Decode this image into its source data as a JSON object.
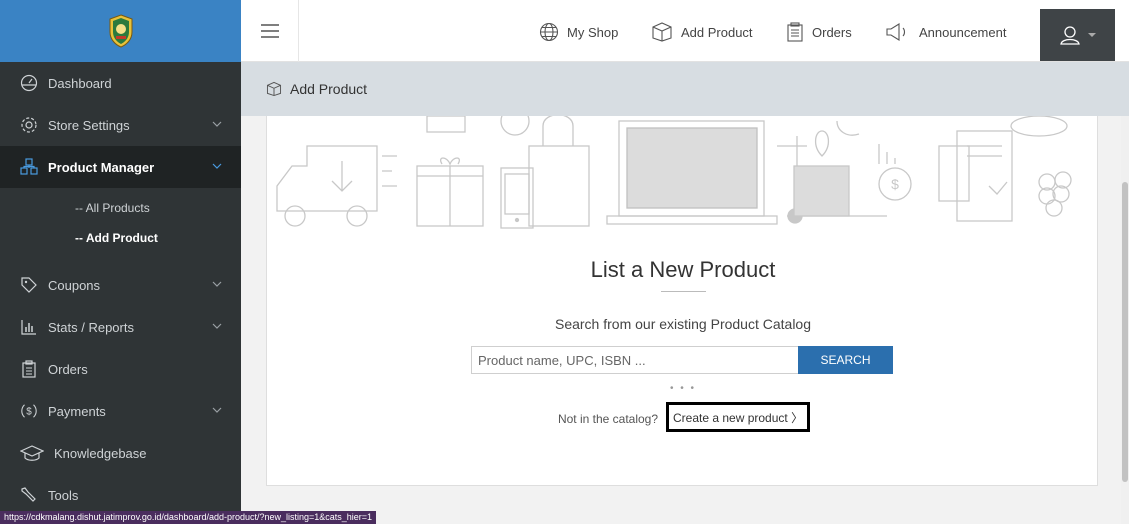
{
  "sidebar": {
    "items": [
      {
        "label": "Dashboard"
      },
      {
        "label": "Store Settings"
      },
      {
        "label": "Product Manager"
      },
      {
        "label": "Coupons"
      },
      {
        "label": "Stats / Reports"
      },
      {
        "label": "Orders"
      },
      {
        "label": "Payments"
      },
      {
        "label": "Knowledgebase"
      },
      {
        "label": "Tools"
      }
    ],
    "sub_items": [
      {
        "label": "-- All Products"
      },
      {
        "label": "-- Add Product"
      }
    ]
  },
  "topbar": {
    "my_shop": "My Shop",
    "add_product": "Add Product",
    "orders": "Orders",
    "announcement": "Announcement"
  },
  "breadcrumb": {
    "title": "Add Product"
  },
  "main": {
    "headline": "List a New Product",
    "subheadline": "Search from our existing Product Catalog",
    "search_placeholder": "Product name, UPC, ISBN ...",
    "search_button": "SEARCH",
    "dots": "• • •",
    "not_in_catalog": "Not in the catalog?",
    "create_link": "Create a new product 〉"
  },
  "status_bar": {
    "url": "https://cdkmalang.dishut.jatimprov.go.id/dashboard/add-product/?new_listing=1&cats_hier=1"
  },
  "colors": {
    "sidebar_bg": "#2f3436",
    "logo_bg": "#3a83c4",
    "accent_button": "#2b6fae",
    "breadcrumb_bg": "#d7dde2"
  }
}
